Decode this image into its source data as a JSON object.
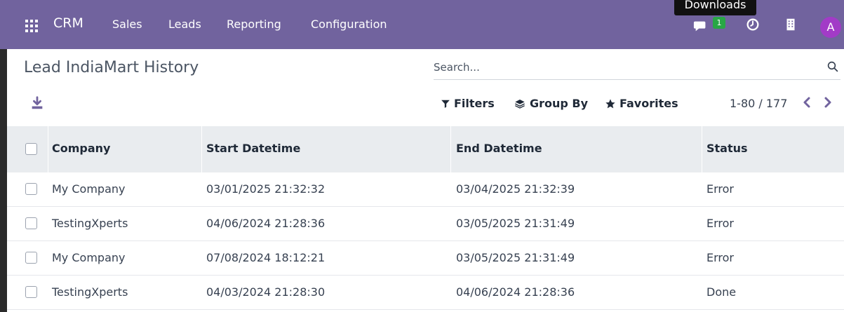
{
  "navbar": {
    "brand": "CRM",
    "menu": [
      "Sales",
      "Leads",
      "Reporting",
      "Configuration"
    ],
    "messages_badge": "1",
    "tooltip": "Downloads",
    "avatar_letter": "A",
    "bg_color": "#71639e"
  },
  "page": {
    "title": "Lead IndiaMart History"
  },
  "search": {
    "placeholder": "Search..."
  },
  "controls": {
    "filters": "Filters",
    "group_by": "Group By",
    "favorites": "Favorites",
    "pager": "1-80 / 177"
  },
  "table": {
    "headers": [
      "Company",
      "Start Datetime",
      "End Datetime",
      "Status"
    ],
    "rows": [
      [
        "My Company",
        "03/01/2025 21:32:32",
        "03/04/2025 21:32:39",
        "Error"
      ],
      [
        "TestingXperts",
        "04/06/2024 21:28:36",
        "03/05/2025 21:31:49",
        "Error"
      ],
      [
        "My Company",
        "07/08/2024 18:12:21",
        "03/05/2025 21:31:49",
        "Error"
      ],
      [
        "TestingXperts",
        "04/03/2024 21:28:30",
        "04/06/2024 21:28:36",
        "Done"
      ]
    ]
  }
}
